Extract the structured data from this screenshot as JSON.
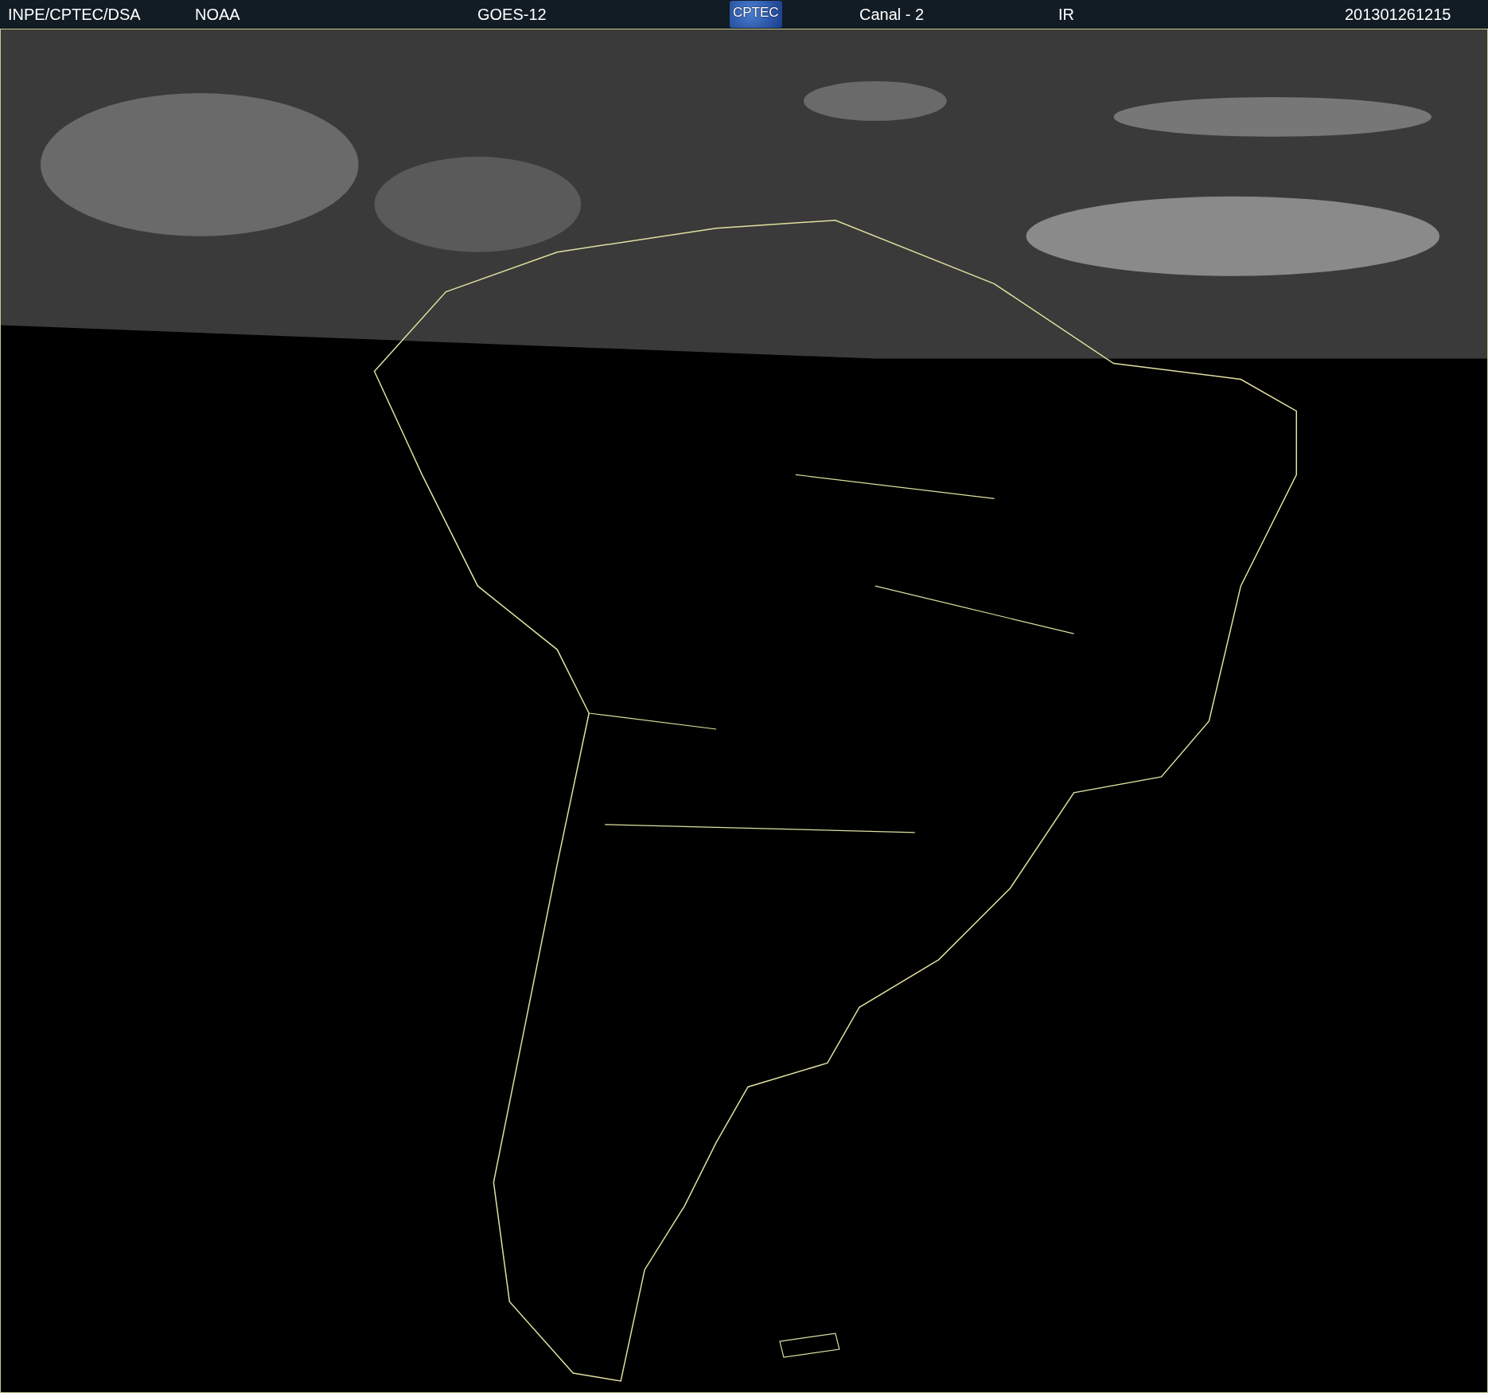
{
  "header": {
    "items": [
      {
        "kind": "text",
        "text": "INPE/CPTEC/DSA"
      },
      {
        "kind": "text",
        "text": "NOAA"
      },
      {
        "kind": "text",
        "text": "GOES-12"
      },
      {
        "kind": "logo",
        "text": "CPTEC"
      },
      {
        "kind": "text",
        "text": "Canal - 2"
      },
      {
        "kind": "text",
        "text": "IR"
      },
      {
        "kind": "text",
        "text": "201301261215"
      }
    ]
  }
}
